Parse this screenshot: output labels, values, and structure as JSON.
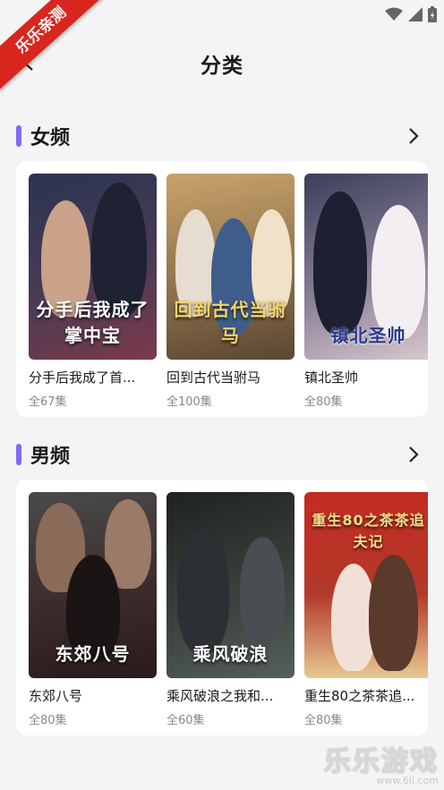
{
  "banner": {
    "text": "乐乐亲测"
  },
  "header": {
    "title": "分类"
  },
  "icons": {
    "back": "chevron-left-icon",
    "more": "chevron-right-icon",
    "wifi": "wifi-icon",
    "signal": "signal-icon",
    "battery": "battery-icon"
  },
  "sections": [
    {
      "title": "女频",
      "items": [
        {
          "poster_text": "分手后我成了掌中宝",
          "name": "分手后我成了首...",
          "count": "全67集",
          "colors": [
            "#2a3550",
            "#7c3a4a"
          ]
        },
        {
          "poster_text": "回到古代当驸马",
          "name": "回到古代当驸马",
          "count": "全100集",
          "colors": [
            "#c9a36a",
            "#5a4632"
          ]
        },
        {
          "poster_text": "镇北圣帅",
          "name": "镇北圣帅",
          "count": "全80集",
          "colors": [
            "#3a3f5a",
            "#d9c8d0"
          ]
        }
      ]
    },
    {
      "title": "男频",
      "items": [
        {
          "poster_text": "东郊八号",
          "name": "东郊八号",
          "count": "全80集",
          "colors": [
            "#4a4a4a",
            "#2a1a1a"
          ]
        },
        {
          "poster_text": "乘风破浪",
          "name": "乘风破浪之我和...",
          "count": "全60集",
          "colors": [
            "#1e2320",
            "#55605a"
          ]
        },
        {
          "poster_text": "重生80之茶茶追夫记",
          "name": "重生80之茶茶追...",
          "count": "全80集",
          "colors": [
            "#c42a22",
            "#e8c890"
          ]
        }
      ]
    }
  ],
  "watermark": {
    "main": "乐乐游戏",
    "sub": "www.6ll.com"
  }
}
